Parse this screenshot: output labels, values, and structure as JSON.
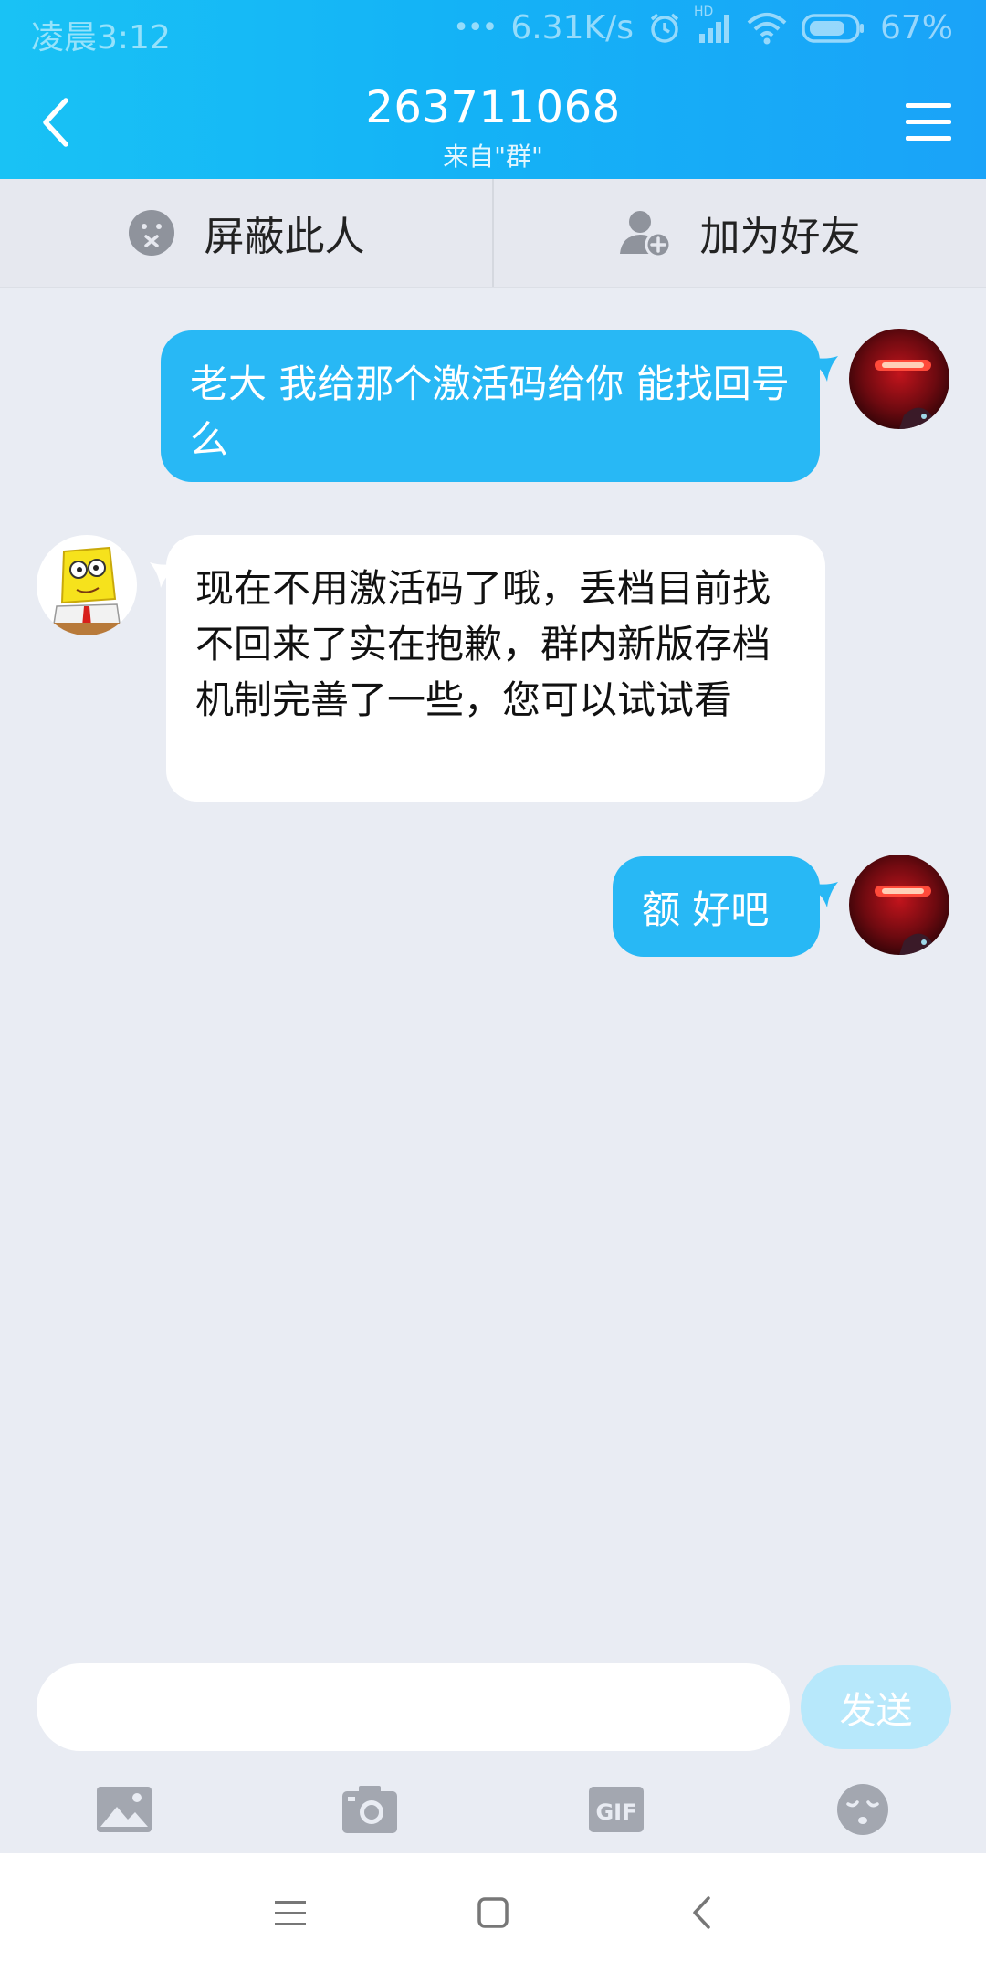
{
  "status_bar": {
    "time": "凌晨3:12",
    "dots": "•••",
    "network_speed": "6.31K/s",
    "signal_label": "HD",
    "battery": "67%"
  },
  "header": {
    "title": "263711068",
    "subtitle": "来自\"群\""
  },
  "actions": {
    "block_label": "屏蔽此人",
    "add_friend_label": "加为好友"
  },
  "messages": [
    {
      "side": "sent",
      "text": "老大  我给那个激活码给你  能找回号么"
    },
    {
      "side": "received",
      "text": "现在不用激活码了哦，丢档目前找不回来了实在抱歉，群内新版存档机制完善了一些，您可以试试看"
    },
    {
      "side": "sent",
      "text": "额  好吧"
    }
  ],
  "input": {
    "placeholder": "",
    "send_label": "发送"
  },
  "toolbar_icons": [
    "image-icon",
    "camera-icon",
    "gif-icon",
    "emoji-icon"
  ],
  "nav_icons": [
    "menu-icon",
    "home-icon",
    "back-icon"
  ],
  "colors": {
    "header_gradient_start": "#19c2f5",
    "header_gradient_end": "#1aa3f8",
    "sent_bubble": "#28b8f5",
    "received_bubble": "#ffffff",
    "background": "#e9ecf3",
    "send_button_disabled": "#b7e8fb"
  }
}
